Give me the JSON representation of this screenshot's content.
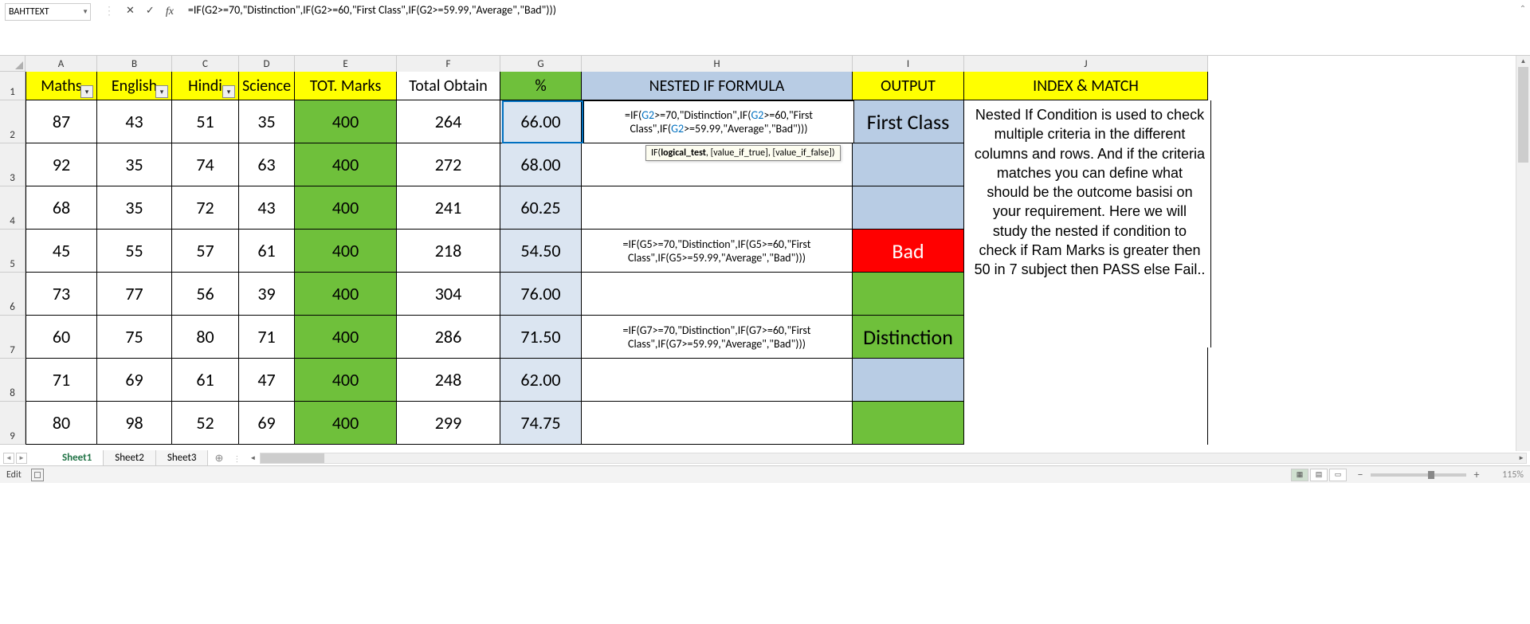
{
  "nameBox": "BAHTTEXT",
  "formula": "=IF(G2>=70,\"Distinction\",IF(G2>=60,\"First Class\",IF(G2>=59.99,\"Average\",\"Bad\")))",
  "tooltip": {
    "fn": "IF",
    "sig": "(logical_test, [value_if_true], [value_if_false])"
  },
  "columns": [
    "A",
    "B",
    "C",
    "D",
    "E",
    "F",
    "G",
    "H",
    "I",
    "J"
  ],
  "headerRow": {
    "A": "Maths",
    "B": "English",
    "C": "Hindi",
    "D": "Science",
    "E": "TOT. Marks",
    "F": "Total Obtain",
    "G": "%",
    "H": "NESTED IF FORMULA",
    "I": "OUTPUT",
    "J": "INDEX & MATCH"
  },
  "rows": [
    {
      "r": 2,
      "A": "87",
      "B": "43",
      "C": "51",
      "D": "35",
      "E": "400",
      "F": "264",
      "G": "66.00",
      "H": "=IF(G2>=70,\"Distinction\",IF(G2>=60,\"First Class\",IF(G2>=59.99,\"Average\",\"Bad\")))",
      "I": "First Class",
      "Iclass": "bluehdr output-big"
    },
    {
      "r": 3,
      "A": "92",
      "B": "35",
      "C": "74",
      "D": "63",
      "E": "400",
      "F": "272",
      "G": "68.00",
      "H": "",
      "I": "",
      "Iclass": "bluehdr"
    },
    {
      "r": 4,
      "A": "68",
      "B": "35",
      "C": "72",
      "D": "43",
      "E": "400",
      "F": "241",
      "G": "60.25",
      "H": "",
      "I": "",
      "Iclass": "bluehdr"
    },
    {
      "r": 5,
      "A": "45",
      "B": "55",
      "C": "57",
      "D": "61",
      "E": "400",
      "F": "218",
      "G": "54.50",
      "H": "=IF(G5>=70,\"Distinction\",IF(G5>=60,\"First Class\",IF(G5>=59.99,\"Average\",\"Bad\")))",
      "I": "Bad",
      "Iclass": "red output-big"
    },
    {
      "r": 6,
      "A": "73",
      "B": "77",
      "C": "56",
      "D": "39",
      "E": "400",
      "F": "304",
      "G": "76.00",
      "H": "",
      "I": "",
      "Iclass": "gfill"
    },
    {
      "r": 7,
      "A": "60",
      "B": "75",
      "C": "80",
      "D": "71",
      "E": "400",
      "F": "286",
      "G": "71.50",
      "H": "=IF(G7>=70,\"Distinction\",IF(G7>=60,\"First Class\",IF(G7>=59.99,\"Average\",\"Bad\")))",
      "I": "Distinction",
      "Iclass": "gfill output-big"
    },
    {
      "r": 8,
      "A": "71",
      "B": "69",
      "C": "61",
      "D": "47",
      "E": "400",
      "F": "248",
      "G": "62.00",
      "H": "",
      "I": "",
      "Iclass": "bluehdr"
    },
    {
      "r": 9,
      "A": "80",
      "B": "98",
      "C": "52",
      "D": "69",
      "E": "400",
      "F": "299",
      "G": "74.75",
      "H": "",
      "I": "",
      "Iclass": "gfill"
    }
  ],
  "descJ": "Nested If Condition is used to check multiple criteria in the different columns and rows. And if the criteria matches you can define what should be the outcome basisi on your requirement. Here we will study the nested if condition to check if Ram Marks is greater then 50 in 7 subject then PASS else Fail..",
  "sheets": {
    "tabs": [
      "Sheet1",
      "Sheet2",
      "Sheet3"
    ],
    "active": 0
  },
  "status": {
    "mode": "Edit",
    "zoom": "115%"
  }
}
